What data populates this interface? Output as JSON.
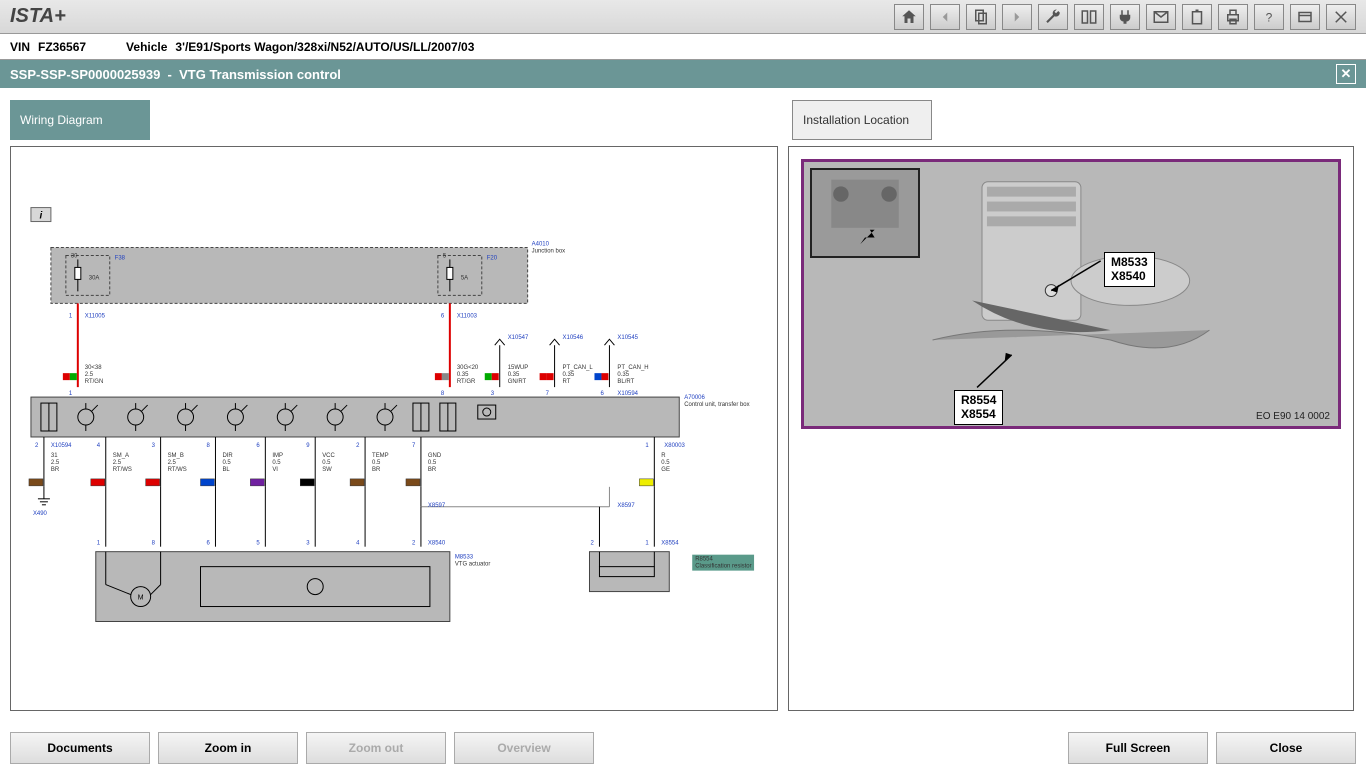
{
  "app": {
    "title": "ISTA+"
  },
  "info": {
    "vin_label": "VIN",
    "vin": "FZ36567",
    "veh_label": "Vehicle",
    "veh": "3'/E91/Sports Wagon/328xi/N52/AUTO/US/LL/2007/03"
  },
  "doc": {
    "id": "SSP-SSP-SP0000025939",
    "title": "VTG Transmission control"
  },
  "tabs": {
    "wiring": "Wiring Diagram",
    "loc": "Installation Location"
  },
  "diagram": {
    "junction": {
      "ref": "A4010",
      "name": "Junction box",
      "fuses": [
        {
          "ref": "F38",
          "rating": "30A",
          "label": "30"
        },
        {
          "ref": "F20",
          "rating": "5A",
          "label": "5"
        }
      ]
    },
    "top_conn": [
      {
        "pin": "1",
        "ref": "X11005",
        "sig": "30<38",
        "ga": "2.5",
        "col": "RT/GN",
        "swatch1": "#d00",
        "swatch2": "#0a0"
      },
      {
        "pin": "6",
        "ref": "X11003",
        "sig": "30G<20",
        "ga": "0.35",
        "col": "RT/GR",
        "swatch1": "#d00",
        "swatch2": "#888"
      }
    ],
    "han_conn": [
      {
        "pin": "3",
        "ref": "X10547",
        "sig": "15WUP",
        "ga": "0.35",
        "col": "GN/RT",
        "swatch1": "#0a0",
        "swatch2": "#d00"
      },
      {
        "pin": "7",
        "ref": "X10546",
        "sig": "PT_CAN_L",
        "ga": "0.35",
        "col": "RT",
        "swatch1": "#d00",
        "swatch2": "#d00"
      },
      {
        "pin": "6",
        "ref": "X10545",
        "sig": "PT_CAN_H",
        "ga": "0.35",
        "col": "BL/RT",
        "swatch1": "#04c",
        "swatch2": "#d00"
      }
    ],
    "ecu": {
      "ref": "A70006",
      "name": "Control unit, transfer box",
      "x_top": "X10594",
      "x_left": "X10594",
      "x_right": "X80003"
    },
    "bottom_conn": [
      {
        "pin": "2",
        "sig": "31",
        "ga": "2.5",
        "col": "BR",
        "swatch": "#7a4a1a"
      },
      {
        "pin": "4",
        "sig": "SM_A",
        "ga": "2.5",
        "col": "RT/WS",
        "swatch": "#d00"
      },
      {
        "pin": "3",
        "sig": "SM_B",
        "ga": "2.5",
        "col": "RT/WS",
        "swatch": "#d00"
      },
      {
        "pin": "8",
        "sig": "DIR",
        "ga": "0.5",
        "col": "BL",
        "swatch": "#04c"
      },
      {
        "pin": "6",
        "sig": "IMP",
        "ga": "0.5",
        "col": "VI",
        "swatch": "#7020a0"
      },
      {
        "pin": "9",
        "sig": "VCC",
        "ga": "0.5",
        "col": "SW",
        "swatch": "#000"
      },
      {
        "pin": "2",
        "sig": "TEMP",
        "ga": "0.5",
        "col": "BR",
        "swatch": "#7a4a1a"
      },
      {
        "pin": "7",
        "sig": "GND",
        "ga": "0.5",
        "col": "BR",
        "swatch": "#7a4a1a"
      },
      {
        "pin": "1",
        "sig": "R",
        "ga": "0.5",
        "col": "GE",
        "swatch": "#ee0"
      }
    ],
    "gnd": {
      "ref": "X490"
    },
    "actuator": {
      "ref": "M8533",
      "name": "VTG actuator",
      "conn_top": "X8597",
      "conn": "X8540"
    },
    "resistor": {
      "ref": "R8554",
      "name": "Classification resistor",
      "conn_top": "X8597",
      "conn": "X8554"
    }
  },
  "loc": {
    "labels": [
      {
        "l1": "M8533",
        "l2": "X8540"
      },
      {
        "l1": "R8554",
        "l2": "X8554"
      }
    ],
    "imgref": "EO E90 14 0002"
  },
  "buttons": {
    "docs": "Documents",
    "zin": "Zoom in",
    "zout": "Zoom out",
    "ov": "Overview",
    "fs": "Full Screen",
    "close": "Close"
  }
}
